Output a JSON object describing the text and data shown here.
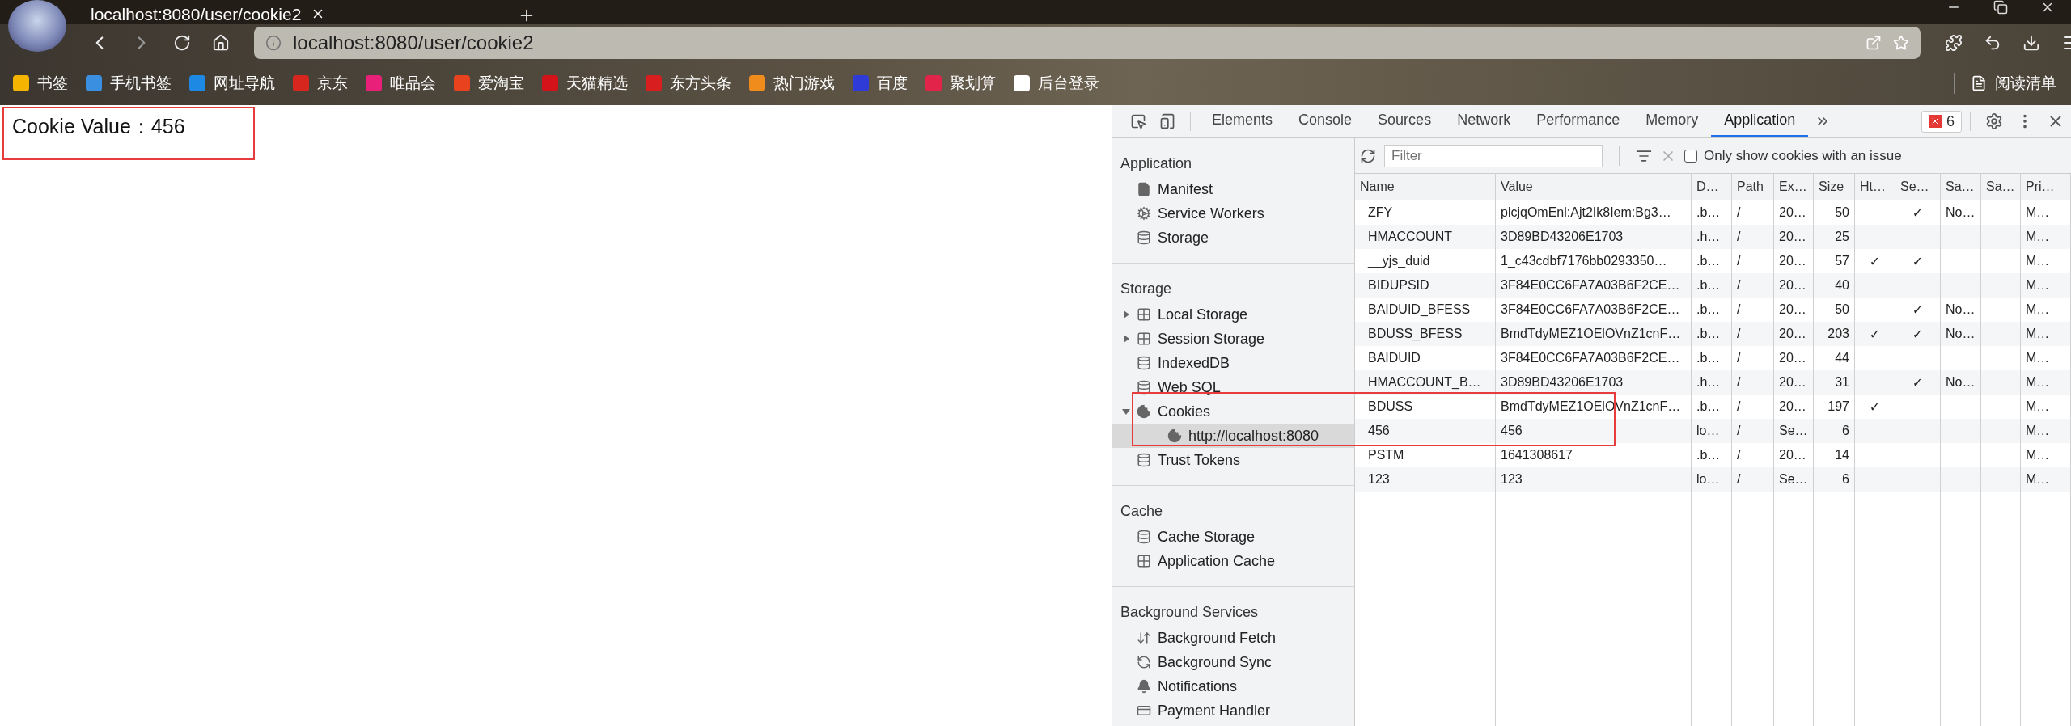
{
  "browser": {
    "tab": {
      "title": "localhost:8080/user/cookie2"
    },
    "address": "localhost:8080/user/cookie2",
    "bookmarks": [
      {
        "label": "书签",
        "color": "#f5b400"
      },
      {
        "label": "手机书签",
        "color": "#3b8fe0"
      },
      {
        "label": "网址导航",
        "color": "#1e88e5"
      },
      {
        "label": "京东",
        "color": "#d7261e"
      },
      {
        "label": "唯品会",
        "color": "#e8207a"
      },
      {
        "label": "爱淘宝",
        "color": "#e8431e"
      },
      {
        "label": "天猫精选",
        "color": "#d4121a"
      },
      {
        "label": "东方头条",
        "color": "#d81e1e"
      },
      {
        "label": "热门游戏",
        "color": "#f08c1c"
      },
      {
        "label": "百度",
        "color": "#2f3bd6"
      },
      {
        "label": "聚划算",
        "color": "#e2234a"
      },
      {
        "label": "后台登录",
        "color": "#ffffff"
      }
    ],
    "reading_list": "阅读清单"
  },
  "page": {
    "text": "Cookie Value：456"
  },
  "devtools": {
    "tabs": [
      {
        "label": "Elements",
        "selected": false
      },
      {
        "label": "Console",
        "selected": false
      },
      {
        "label": "Sources",
        "selected": false
      },
      {
        "label": "Network",
        "selected": false
      },
      {
        "label": "Performance",
        "selected": false
      },
      {
        "label": "Memory",
        "selected": false
      },
      {
        "label": "Application",
        "selected": true
      }
    ],
    "error_count": "6",
    "filter": {
      "placeholder": "Filter"
    },
    "issue_filter": {
      "label": "Only show cookies with an issue",
      "checked": false
    },
    "sidebar": [
      {
        "heading": "Application",
        "items": [
          {
            "label": "Manifest",
            "kind": "file"
          },
          {
            "label": "Service Workers",
            "kind": "gear"
          },
          {
            "label": "Storage",
            "kind": "database"
          }
        ]
      },
      {
        "heading": "Storage",
        "items": [
          {
            "label": "Local Storage",
            "kind": "grid",
            "expanded": false
          },
          {
            "label": "Session Storage",
            "kind": "grid",
            "expanded": false
          },
          {
            "label": "IndexedDB",
            "kind": "database"
          },
          {
            "label": "Web SQL",
            "kind": "database"
          },
          {
            "label": "Cookies",
            "kind": "cookie",
            "expanded": true,
            "children": [
              {
                "label": "http://localhost:8080",
                "kind": "cookie",
                "selected": true
              }
            ]
          },
          {
            "label": "Trust Tokens",
            "kind": "database"
          }
        ]
      },
      {
        "heading": "Cache",
        "items": [
          {
            "label": "Cache Storage",
            "kind": "database"
          },
          {
            "label": "Application Cache",
            "kind": "grid"
          }
        ]
      },
      {
        "heading": "Background Services",
        "items": [
          {
            "label": "Background Fetch",
            "kind": "fetch"
          },
          {
            "label": "Background Sync",
            "kind": "sync"
          },
          {
            "label": "Notifications",
            "kind": "bell"
          },
          {
            "label": "Payment Handler",
            "kind": "card"
          }
        ]
      }
    ],
    "table": {
      "columns": [
        "Name",
        "Value",
        "D…",
        "Path",
        "Ex…",
        "Size",
        "Ht…",
        "Se…",
        "Sa…",
        "Sa…",
        "Pri…"
      ],
      "rows": [
        {
          "name": "ZFY",
          "value": "plcjqOmEnl:Ajt2Ik8Iem:Bg3…",
          "column_3": ".b…",
          "path": "/",
          "column_5": "20…",
          "size": "50",
          "column_8": "✓",
          "column_9": "No…",
          "column_11": "M…"
        },
        {
          "name": "HMACCOUNT",
          "value": "3D89BD43206E1703",
          "column_3": ".h…",
          "path": "/",
          "column_5": "20…",
          "size": "25",
          "column_11": "M…"
        },
        {
          "name": "__yjs_duid",
          "value": "1_c43cdbf7176bb0293350…",
          "column_3": ".b…",
          "path": "/",
          "column_5": "20…",
          "size": "57",
          "column_7": "✓",
          "column_8": "✓",
          "column_11": "M…"
        },
        {
          "name": "BIDUPSID",
          "value": "3F84E0CC6FA7A03B6F2CE…",
          "column_3": ".b…",
          "path": "/",
          "column_5": "20…",
          "size": "40",
          "column_11": "M…"
        },
        {
          "name": "BAIDUID_BFESS",
          "value": "3F84E0CC6FA7A03B6F2CE…",
          "column_3": ".b…",
          "path": "/",
          "column_5": "20…",
          "size": "50",
          "column_8": "✓",
          "column_9": "No…",
          "column_11": "M…"
        },
        {
          "name": "BDUSS_BFESS",
          "value": "BmdTdyMEZ1OElOVnZ1cnF…",
          "column_3": ".b…",
          "path": "/",
          "column_5": "20…",
          "size": "203",
          "column_7": "✓",
          "column_8": "✓",
          "column_9": "No…",
          "column_11": "M…"
        },
        {
          "name": "BAIDUID",
          "value": "3F84E0CC6FA7A03B6F2CE…",
          "column_3": ".b…",
          "path": "/",
          "column_5": "20…",
          "size": "44",
          "column_11": "M…"
        },
        {
          "name": "HMACCOUNT_B…",
          "value": "3D89BD43206E1703",
          "column_3": ".h…",
          "path": "/",
          "column_5": "20…",
          "size": "31",
          "column_8": "✓",
          "column_9": "No…",
          "column_11": "M…"
        },
        {
          "name": "BDUSS",
          "value": "BmdTdyMEZ1OElOVnZ1cnF…",
          "column_3": ".b…",
          "path": "/",
          "column_5": "20…",
          "size": "197",
          "column_7": "✓",
          "column_11": "M…"
        },
        {
          "name": "456",
          "value": "456",
          "column_3": "lo…",
          "path": "/",
          "column_5": "Se…",
          "size": "6",
          "column_11": "M…"
        },
        {
          "name": "PSTM",
          "value": "1641308617",
          "column_3": ".b…",
          "path": "/",
          "column_5": "20…",
          "size": "14",
          "column_11": "M…"
        },
        {
          "name": "123",
          "value": "123",
          "column_3": "lo…",
          "path": "/",
          "column_5": "Se…",
          "size": "6",
          "column_11": "M…"
        }
      ]
    }
  }
}
